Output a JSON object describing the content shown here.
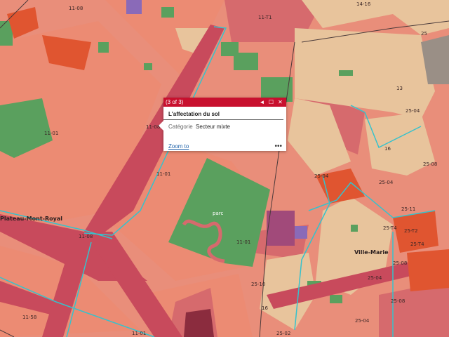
{
  "colors": {
    "base": "#e98e7a",
    "mixte": "#e6826d",
    "residential": "#d9606f",
    "institutional": "#e8c09a",
    "park": "#5aa05e",
    "street": "#c84a5c",
    "outline": "#36c2cc",
    "popup_header": "#c8102e"
  },
  "map": {
    "labels": {
      "l1": "11-08",
      "l2": "11-T1",
      "l3": "14-16",
      "l4": "11-01",
      "l5": "11-01",
      "l6": "11-01",
      "l7": "11-01",
      "l8": "11-08",
      "l9": "parc",
      "l10": "Plateau-Mont-Royal",
      "l11": "Ville-Marie",
      "l12": "25-04",
      "l13": "25-08",
      "l14": "25-04",
      "l15": "25-11",
      "l16": "25-T4",
      "l17": "25-T2",
      "l18": "25-04",
      "l19": "25-08",
      "l20": "25-04",
      "l21": "25-08",
      "l22": "25-02",
      "l23": "25-04",
      "l24": "11-08",
      "l25": "11-58",
      "l26": "25-10",
      "l27": "25-T4",
      "l28": "16",
      "l29": "16",
      "l30": "25",
      "l31": "13"
    }
  },
  "popup": {
    "counter": "(3 of 3)",
    "title": "L'affectation du sol",
    "field_label": "Catégorie",
    "field_value": "Secteur mixte",
    "zoom_label": "Zoom to",
    "more_label": "•••",
    "prev_icon": "◄",
    "maximize_icon": "☐",
    "close_icon": "✕"
  }
}
